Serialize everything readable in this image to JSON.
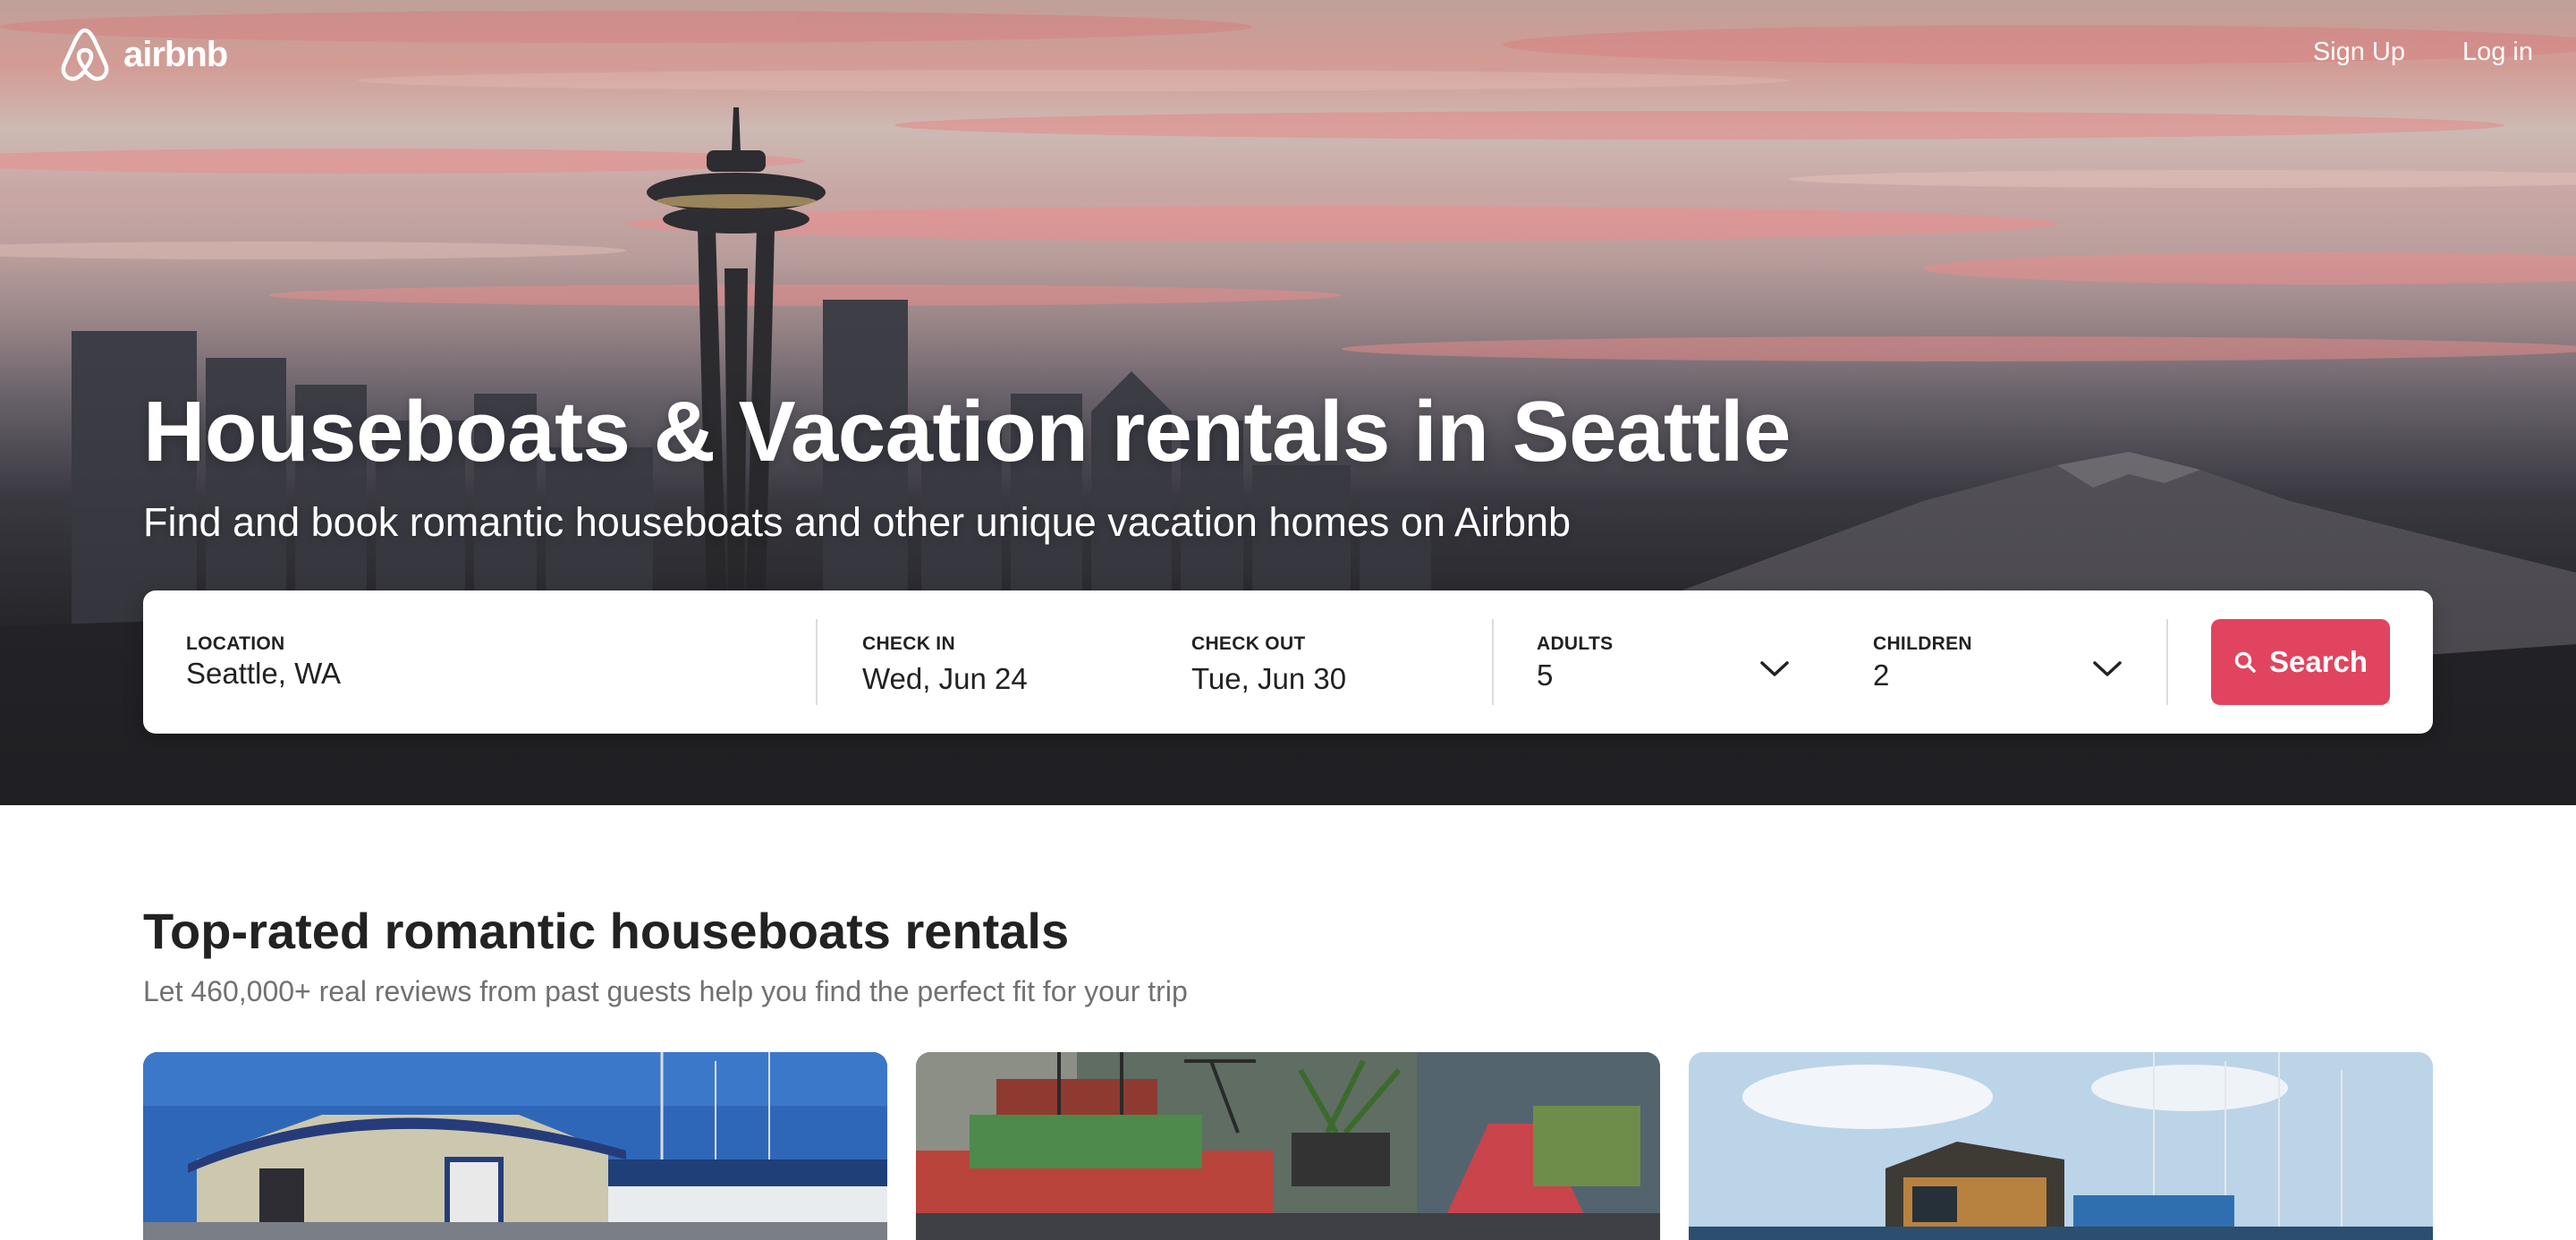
{
  "brand": {
    "name": "airbnb",
    "accent": "#e0445f"
  },
  "nav": {
    "signup": "Sign Up",
    "login": "Log in"
  },
  "hero": {
    "title": "Houseboats & Vacation rentals in Seattle",
    "subtitle": "Find and book romantic houseboats and other unique vacation homes on Airbnb"
  },
  "search": {
    "location": {
      "label": "LOCATION",
      "value": "Seattle, WA"
    },
    "checkin": {
      "label": "CHECK IN",
      "value": "Wed, Jun 24"
    },
    "checkout": {
      "label": "CHECK OUT",
      "value": "Tue, Jun 30"
    },
    "adults": {
      "label": "ADULTS",
      "value": "5"
    },
    "children": {
      "label": "CHILDREN",
      "value": "2"
    },
    "button": "Search"
  },
  "listings": {
    "title": "Top-rated romantic houseboats rentals",
    "subtitle": "Let 460,000+ real reviews from past guests help you find the perfect fit for your trip",
    "cards": [
      {
        "icon": "houseboat-photo-1"
      },
      {
        "icon": "houseboat-photo-2"
      },
      {
        "icon": "houseboat-photo-3"
      }
    ]
  }
}
